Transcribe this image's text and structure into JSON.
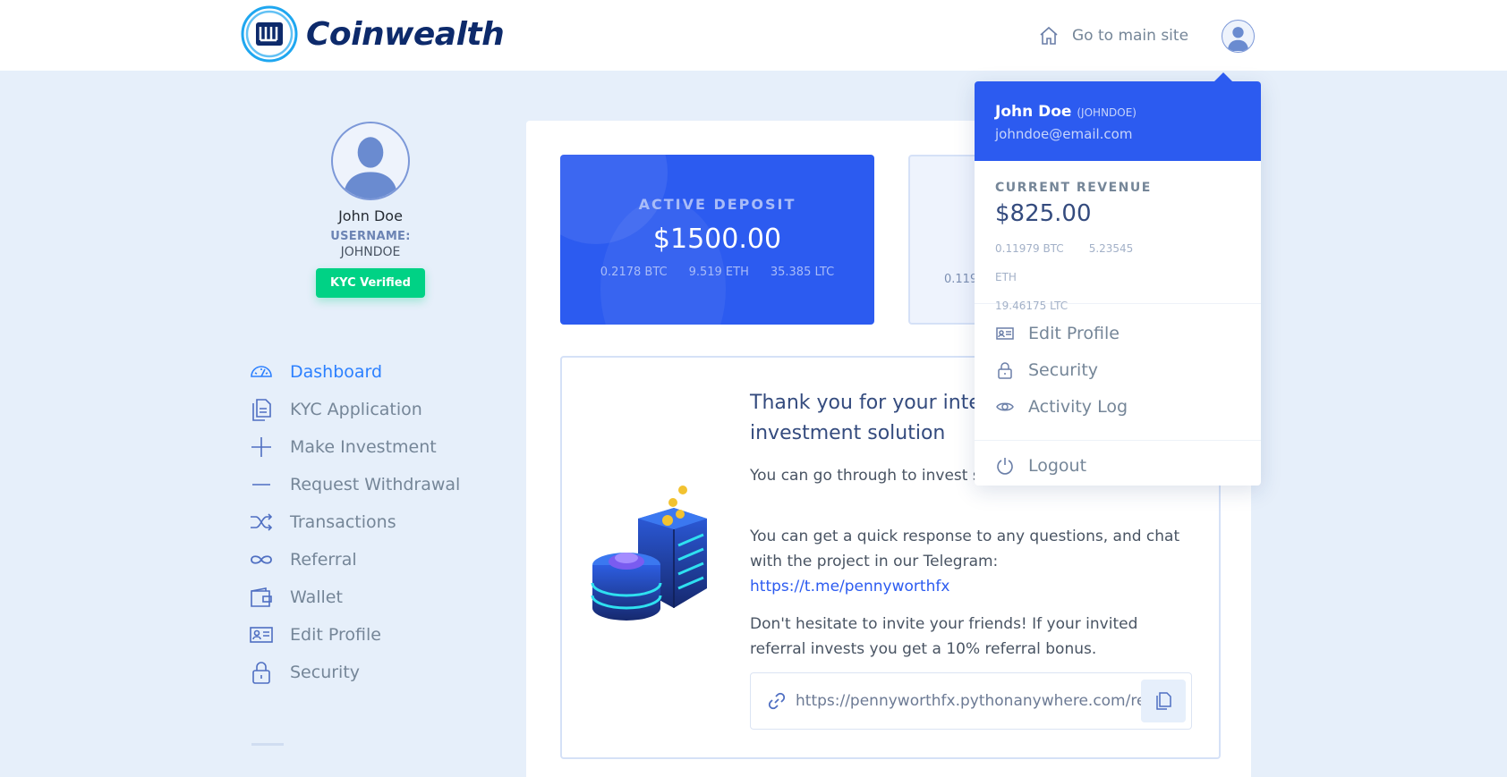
{
  "brand": {
    "name": "Coinwealth"
  },
  "topnav": {
    "home_label": "Go to main site"
  },
  "profile": {
    "name": "John Doe",
    "username_label": "USERNAME:",
    "username": "JOHNDOE",
    "kyc_badge": "KYC Verified"
  },
  "sidebar": {
    "items": [
      {
        "label": "Dashboard",
        "icon": "dashboard-icon",
        "active": true
      },
      {
        "label": "KYC Application",
        "icon": "documents-icon"
      },
      {
        "label": "Make Investment",
        "icon": "plus-icon"
      },
      {
        "label": "Request Withdrawal",
        "icon": "minus-icon"
      },
      {
        "label": "Transactions",
        "icon": "shuffle-icon"
      },
      {
        "label": "Referral",
        "icon": "infinity-icon"
      },
      {
        "label": "Wallet",
        "icon": "wallet-icon"
      },
      {
        "label": "Edit Profile",
        "icon": "id-card-icon"
      },
      {
        "label": "Security",
        "icon": "lock-icon"
      }
    ]
  },
  "cards": {
    "active_deposit": {
      "label": "ACTIVE DEPOSIT",
      "amount": "$1500.00",
      "btc": "0.2178 BTC",
      "eth": "9.519 ETH",
      "ltc": "35.385 LTC"
    },
    "second": {
      "btc_partial": "0.1197"
    }
  },
  "welcome": {
    "title": "Thank you for your interest in our investment solution",
    "p1": "You can go through to invest section.",
    "p2": "You can get a quick response to any questions, and chat with the project in our Telegram:",
    "telegram_link": "https://t.me/pennyworthfx",
    "p3": "Don't hesitate to invite your friends! If your invited referral invests you get a 10% referral bonus.",
    "referral_url": "https://pennyworthfx.pythonanywhere.com/ref"
  },
  "dropdown": {
    "name": "John Doe",
    "username": "(JOHNDOE)",
    "email": "johndoe@email.com",
    "revenue_label": "CURRENT REVENUE",
    "revenue_amount": "$825.00",
    "btc": "0.11979 BTC",
    "eth": "5.23545 ETH",
    "ltc": "19.46175 LTC",
    "items": [
      {
        "label": "Edit Profile",
        "icon": "id-card-icon"
      },
      {
        "label": "Security",
        "icon": "lock-icon"
      },
      {
        "label": "Activity Log",
        "icon": "eye-icon"
      }
    ],
    "logout": "Logout"
  },
  "colors": {
    "primary": "#2c5bf0",
    "success": "#00d285",
    "background": "#e6effa"
  }
}
